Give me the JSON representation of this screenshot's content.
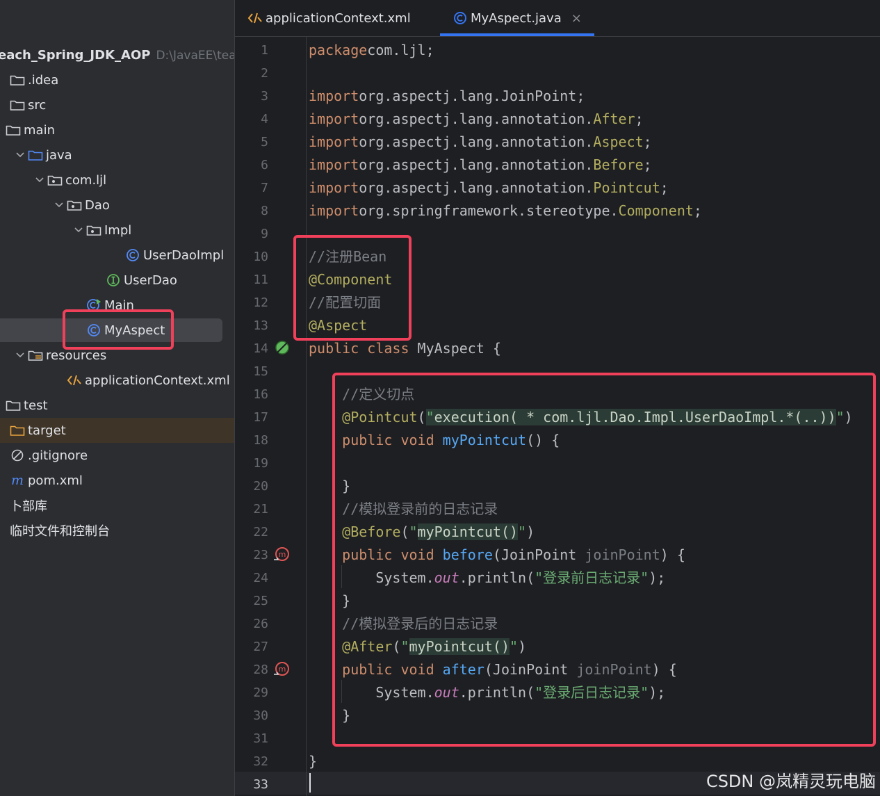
{
  "project": {
    "name": "each_Spring_JDK_AOP",
    "path": "D:\\JavaEE\\teach"
  },
  "tree": [
    {
      "label": ".idea",
      "icon": "folder-icon"
    },
    {
      "label": "src",
      "icon": "folder-icon"
    },
    {
      "label": "main",
      "icon": "folder-icon"
    },
    {
      "label": "java",
      "icon": "source-folder-icon"
    },
    {
      "label": "com.ljl",
      "icon": "package-icon"
    },
    {
      "label": "Dao",
      "icon": "package-icon"
    },
    {
      "label": "Impl",
      "icon": "package-icon"
    },
    {
      "label": "UserDaoImpl",
      "icon": "class-icon"
    },
    {
      "label": "UserDao",
      "icon": "interface-icon"
    },
    {
      "label": "Main",
      "icon": "runnable-class-icon"
    },
    {
      "label": "MyAspect",
      "icon": "class-icon"
    },
    {
      "label": "resources",
      "icon": "resources-folder-icon"
    },
    {
      "label": "applicationContext.xml",
      "icon": "xml-file-icon"
    },
    {
      "label": "test",
      "icon": "folder-icon"
    },
    {
      "label": "target",
      "icon": "excluded-folder-icon"
    },
    {
      "label": ".gitignore",
      "icon": "ignore-file-icon"
    },
    {
      "label": "pom.xml",
      "icon": "maven-icon"
    },
    {
      "label": "卜部库",
      "icon": ""
    },
    {
      "label": "临时文件和控制台",
      "icon": ""
    }
  ],
  "tabs": [
    {
      "label": "applicationContext.xml",
      "icon": "xml-file-icon"
    },
    {
      "label": "MyAspect.java",
      "icon": "class-icon",
      "close": "×"
    }
  ],
  "code": {
    "line_numbers": [
      "1",
      "2",
      "3",
      "4",
      "5",
      "6",
      "7",
      "8",
      "9",
      "10",
      "11",
      "12",
      "13",
      "14",
      "15",
      "16",
      "17",
      "18",
      "19",
      "20",
      "21",
      "22",
      "23",
      "24",
      "25",
      "26",
      "27",
      "28",
      "29",
      "30",
      "31",
      "32",
      "33"
    ],
    "lines": [
      [
        [
          "kw",
          "package"
        ],
        [
          "",
          "com.ljl;"
        ]
      ],
      [],
      [
        [
          "kw",
          "import"
        ],
        [
          "",
          "org.aspectj.lang.JoinPoint;"
        ]
      ],
      [
        [
          "kw",
          "import"
        ],
        [
          "",
          "org.aspectj.lang.annotation."
        ],
        [
          "clsy",
          "After"
        ],
        [
          "",
          ";"
        ]
      ],
      [
        [
          "kw",
          "import"
        ],
        [
          "",
          "org.aspectj.lang.annotation."
        ],
        [
          "clsy",
          "Aspect"
        ],
        [
          "",
          ";"
        ]
      ],
      [
        [
          "kw",
          "import"
        ],
        [
          "",
          "org.aspectj.lang.annotation."
        ],
        [
          "clsy",
          "Before"
        ],
        [
          "",
          ";"
        ]
      ],
      [
        [
          "kw",
          "import"
        ],
        [
          "",
          "org.aspectj.lang.annotation."
        ],
        [
          "clsy",
          "Pointcut"
        ],
        [
          "",
          ";"
        ]
      ],
      [
        [
          "kw",
          "import"
        ],
        [
          "",
          "org.springframework.stereotype."
        ],
        [
          "clsy",
          "Component"
        ],
        [
          "",
          ";"
        ]
      ],
      [],
      [
        [
          "cm",
          "//注册Bean"
        ]
      ],
      [
        [
          "ann",
          "@Component"
        ]
      ],
      [
        [
          "cm",
          "//配置切面"
        ]
      ],
      [
        [
          "ann",
          "@Aspect"
        ]
      ],
      [
        [
          "kw",
          "public class"
        ],
        [
          "",
          " MyAspect {"
        ]
      ],
      [],
      [
        [
          "cm",
          "    //定义切点"
        ]
      ],
      [
        [
          "ann",
          "    @Pointcut"
        ],
        [
          "",
          "("
        ],
        [
          "strbg",
          "\""
        ],
        [
          "strp",
          "execution( * com.ljl.Dao.Impl.UserDaoImpl.*(..))"
        ],
        [
          "str",
          "\""
        ],
        [
          "",
          ")"
        ]
      ],
      [
        [
          "kw",
          "    public void"
        ],
        [
          "fn",
          " myPointcut"
        ],
        [
          "",
          "() {"
        ]
      ],
      [],
      [
        [
          "",
          "    }"
        ]
      ],
      [
        [
          "cm",
          "    //模拟登录前的日志记录"
        ]
      ],
      [
        [
          "ann",
          "    @Before"
        ],
        [
          "",
          "("
        ],
        [
          "str",
          "\""
        ],
        [
          "strp",
          "myPointcut()"
        ],
        [
          "str",
          "\""
        ],
        [
          "",
          ")"
        ]
      ],
      [
        [
          "kw",
          "    public void"
        ],
        [
          "fn",
          " before"
        ],
        [
          "",
          "(JoinPoint "
        ],
        [
          "param",
          "joinPoint"
        ],
        [
          "",
          ") {"
        ]
      ],
      [
        [
          "",
          "        System."
        ],
        [
          "fld",
          "out"
        ],
        [
          "",
          ".println("
        ],
        [
          "str",
          "\"登录前日志记录\""
        ],
        [
          "",
          ");"
        ]
      ],
      [
        [
          "",
          "    }"
        ]
      ],
      [
        [
          "cm",
          "    //模拟登录后的日志记录"
        ]
      ],
      [
        [
          "ann",
          "    @After"
        ],
        [
          "",
          "("
        ],
        [
          "str",
          "\""
        ],
        [
          "strp",
          "myPointcut()"
        ],
        [
          "str",
          "\""
        ],
        [
          "",
          ")"
        ]
      ],
      [
        [
          "kw",
          "    public void"
        ],
        [
          "fn",
          " after"
        ],
        [
          "",
          "(JoinPoint "
        ],
        [
          "param",
          "joinPoint"
        ],
        [
          "",
          ") {"
        ]
      ],
      [
        [
          "",
          "        System."
        ],
        [
          "fld",
          "out"
        ],
        [
          "",
          ".println("
        ],
        [
          "str",
          "\"登录后日志记录\""
        ],
        [
          "",
          ");"
        ]
      ],
      [
        [
          "",
          "    }"
        ]
      ],
      [],
      [
        [
          "",
          "}"
        ]
      ],
      []
    ]
  },
  "watermark": "CSDN @岚精灵玩电脑",
  "colors": {
    "accent": "#3574f0",
    "highlight_box": "#f0405a",
    "keyword": "#cf8e6d",
    "annotation": "#b3ae60",
    "comment": "#7a7e85",
    "string": "#6aab73",
    "method": "#56a8f5"
  }
}
